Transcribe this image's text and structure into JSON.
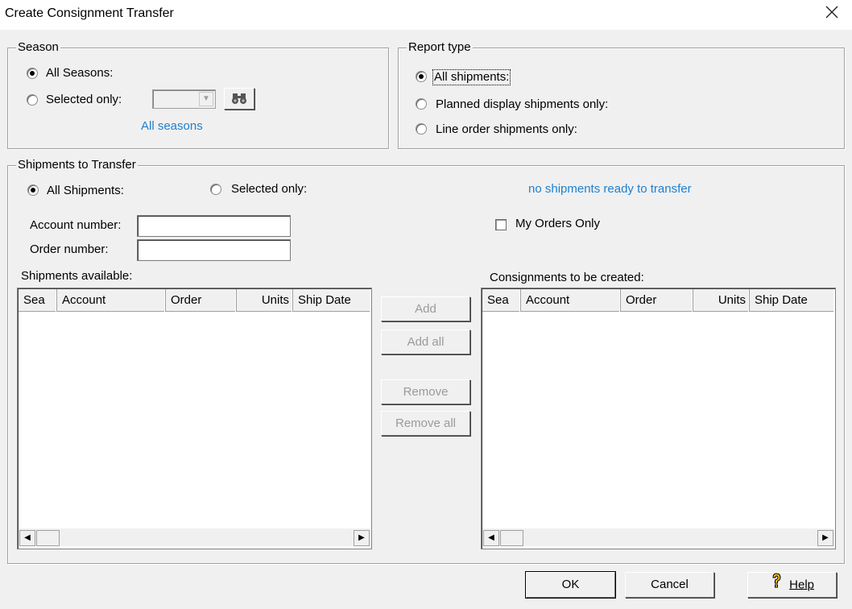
{
  "window": {
    "title": "Create Consignment Transfer",
    "close_icon": "close-icon"
  },
  "season": {
    "group_title": "Season",
    "all_label": "All Seasons:",
    "all_selected": true,
    "selected_label": "Selected only:",
    "combo_value": "",
    "find_icon": "binoculars-icon",
    "link": "All seasons"
  },
  "report_type": {
    "group_title": "Report type",
    "options": [
      {
        "label": "All shipments:",
        "selected": true
      },
      {
        "label": "Planned display shipments only:",
        "selected": false
      },
      {
        "label": "Line order shipments only:",
        "selected": false
      }
    ]
  },
  "shipments": {
    "group_title": "Shipments to Transfer",
    "all_label": "All Shipments:",
    "all_selected": true,
    "selected_label": "Selected only:",
    "status_link": "no shipments ready to transfer",
    "account_label": "Account number:",
    "account_value": "",
    "order_label": "Order number:",
    "order_value": "",
    "my_orders_label": "My Orders Only",
    "my_orders_checked": false,
    "available_label": "Shipments available:",
    "created_label": "Consignments to be created:",
    "columns": [
      "Sea",
      "Account",
      "Order",
      "Units",
      "Ship Date"
    ],
    "available_rows": [],
    "created_rows": []
  },
  "transfer_buttons": {
    "add": "Add",
    "add_all": "Add all",
    "remove": "Remove",
    "remove_all": "Remove all"
  },
  "footer": {
    "ok": "OK",
    "cancel": "Cancel",
    "help": "Help",
    "help_icon": "help-question-icon"
  },
  "colors": {
    "link": "#1e7fd0",
    "background": "#f0f0f0"
  }
}
